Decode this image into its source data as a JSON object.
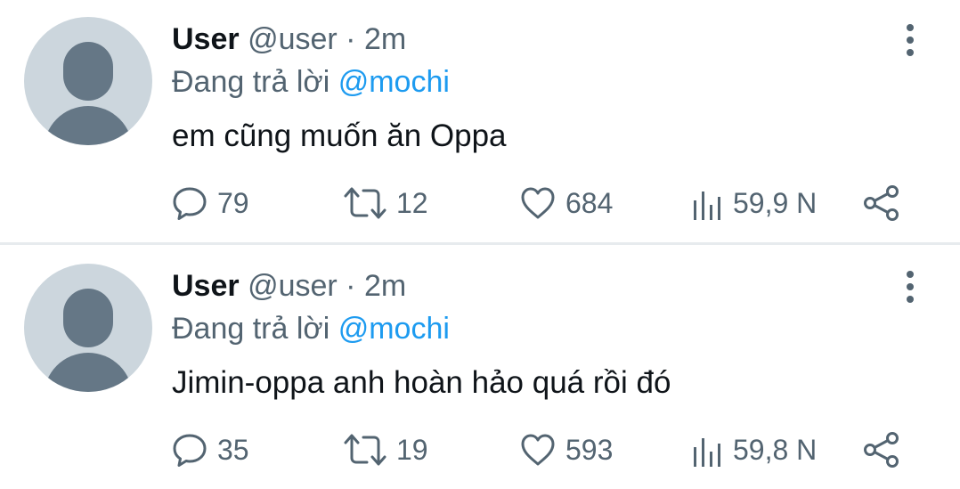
{
  "tweets": [
    {
      "display_name": "User",
      "handle": "@user",
      "separator": "·",
      "time": "2m",
      "replying_prefix": "Đang trả lời",
      "replying_to": "@mochi",
      "text": "em cũng muốn ăn Oppa",
      "stats": {
        "replies": "79",
        "retweets": "12",
        "likes": "684",
        "views": "59,9 N"
      }
    },
    {
      "display_name": "User",
      "handle": "@user",
      "separator": "·",
      "time": "2m",
      "replying_prefix": "Đang trả lời",
      "replying_to": "@mochi",
      "text": "Jimin-oppa anh hoàn hảo quá rồi đó",
      "stats": {
        "replies": "35",
        "retweets": "19",
        "likes": "593",
        "views": "59,8 N"
      }
    }
  ],
  "icons": {
    "reply": "reply-icon",
    "retweet": "retweet-icon",
    "like": "heart-icon",
    "views": "views-icon",
    "share": "share-icon",
    "more": "more-icon",
    "avatar": "default-avatar"
  },
  "colors": {
    "text": "#0f1419",
    "muted": "#536471",
    "link": "#1d9bf0",
    "avatar_bg": "#ccd6dd",
    "avatar_fg": "#657786",
    "divider": "#e7ebee"
  }
}
